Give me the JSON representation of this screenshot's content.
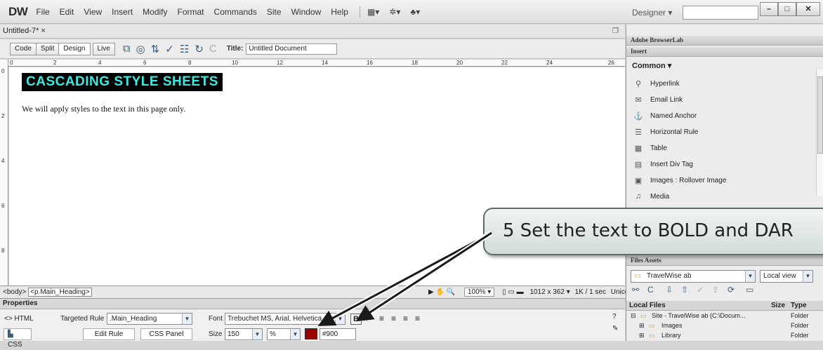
{
  "app": {
    "logo": "DW"
  },
  "menu": [
    "File",
    "Edit",
    "View",
    "Insert",
    "Modify",
    "Format",
    "Commands",
    "Site",
    "Window",
    "Help"
  ],
  "workspace": {
    "designer_label": "Designer",
    "search_value": ""
  },
  "document": {
    "tab_label": "Untitled-7*",
    "view_buttons": [
      "Code",
      "Split",
      "Design",
      "Live"
    ],
    "title_label": "Title:",
    "title_value": "Untitled Document",
    "ruler_h": [
      "0",
      "2",
      "4",
      "6",
      "8",
      "10",
      "12",
      "14",
      "16",
      "18",
      "20",
      "22",
      "24",
      "26"
    ],
    "ruler_v": [
      "0",
      "2",
      "4",
      "6",
      "8"
    ],
    "heading": "CASCADING STYLE SHEETS",
    "paragraph": "We will apply styles to the text in this page only."
  },
  "status": {
    "tag_body": "<body>",
    "tag_p": "<p.Main_Heading>",
    "zoom": "100%",
    "size": "1012 x 362",
    "download": "1K / 1 sec",
    "encoding": "Unicode (UTF-8)"
  },
  "properties": {
    "header": "Properties",
    "html_label": "HTML",
    "css_label": "CSS",
    "targeted_rule_label": "Targeted Rule",
    "targeted_rule_value": ".Main_Heading",
    "edit_rule": "Edit Rule",
    "css_panel": "CSS Panel",
    "font_label": "Font",
    "font_value": "Trebuchet MS, Arial, Helvetica",
    "size_label": "Size",
    "size_value": "150",
    "unit_value": "%",
    "color_value": "#900",
    "color_swatch": "#990000",
    "bold_label": "B"
  },
  "right_panel": {
    "browserlab": "Adobe BrowserLab",
    "insert": "Insert",
    "common": "Common",
    "insert_items": [
      "Hyperlink",
      "Email Link",
      "Named Anchor",
      "Horizontal Rule",
      "Table",
      "Insert Div Tag",
      "Images : Rollover Image",
      "Media"
    ],
    "files_tabs": "Files  Assets",
    "site_value": "TravelWise ab",
    "view_value": "Local view",
    "local_files": "Local Files",
    "size_col": "Size",
    "type_col": "Type",
    "rows": [
      {
        "name": "Site - TravelWise ab (C:\\Docum...",
        "type": "Folder"
      },
      {
        "name": "Images",
        "type": "Folder"
      },
      {
        "name": "Library",
        "type": "Folder"
      }
    ]
  },
  "callout": {
    "text": "5  Set the text to BOLD and DAR"
  }
}
